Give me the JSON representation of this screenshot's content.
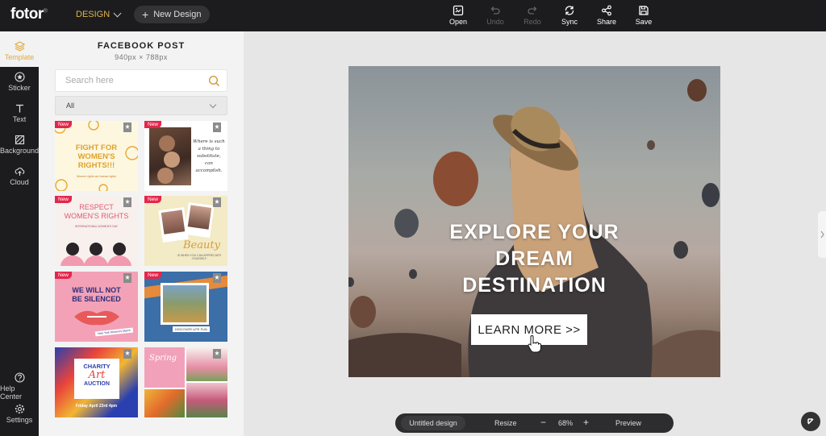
{
  "app": {
    "logo_text": "fotor",
    "logo_mark": "®",
    "design_menu": "DESIGN",
    "new_design": "New Design",
    "accent": "#e0a93c"
  },
  "toolbar": {
    "open": "Open",
    "undo": "Undo",
    "redo": "Redo",
    "sync": "Sync",
    "share": "Share",
    "save": "Save"
  },
  "rail": {
    "template": "Template",
    "sticker": "Sticker",
    "text": "Text",
    "background": "Background",
    "cloud": "Cloud",
    "help": "Help Center",
    "settings": "Settings"
  },
  "panel": {
    "title": "FACEBOOK POST",
    "size": "940px × 788px",
    "search_placeholder": "Search here",
    "filter": "All",
    "new_badge": "New",
    "templates": {
      "t1": {
        "line1": "FIGHT FOR",
        "line2": "WOMEN'S",
        "line3": "RIGHTS!!!",
        "small": "Women rights are human rights"
      },
      "t2": {
        "quote": "Where is such a thing to substitute, can accomplish."
      },
      "t3": {
        "line1": "RESPECT",
        "line2": "WOMEN'S RIGHTS",
        "small": "INTERNATIONAL WOMEN'S DAY"
      },
      "t4": {
        "script": "Beauty",
        "small": "IS WHEN YOU CAN APPRECIATE YOURSELF"
      },
      "t5": {
        "line1": "WE WILL NOT",
        "line2": "BE SILENCED",
        "small": "New York Women's March"
      },
      "t6": {
        "caption": "DISCOVER LIFE FUN"
      },
      "t7": {
        "line1": "CHARITY",
        "line2": "Art",
        "line3": "AUCTION",
        "small": "Friday April 23rd 4pm"
      },
      "t8": {
        "script": "Spring"
      }
    }
  },
  "canvas": {
    "headline_1": "EXPLORE YOUR",
    "headline_2": "DREAM",
    "headline_3": "DESTINATION",
    "cta": "LEARN MORE >>"
  },
  "bottom": {
    "design_name": "Untitled design",
    "resize": "Resize",
    "zoom": "68%",
    "minus": "−",
    "plus": "+",
    "preview": "Preview"
  }
}
